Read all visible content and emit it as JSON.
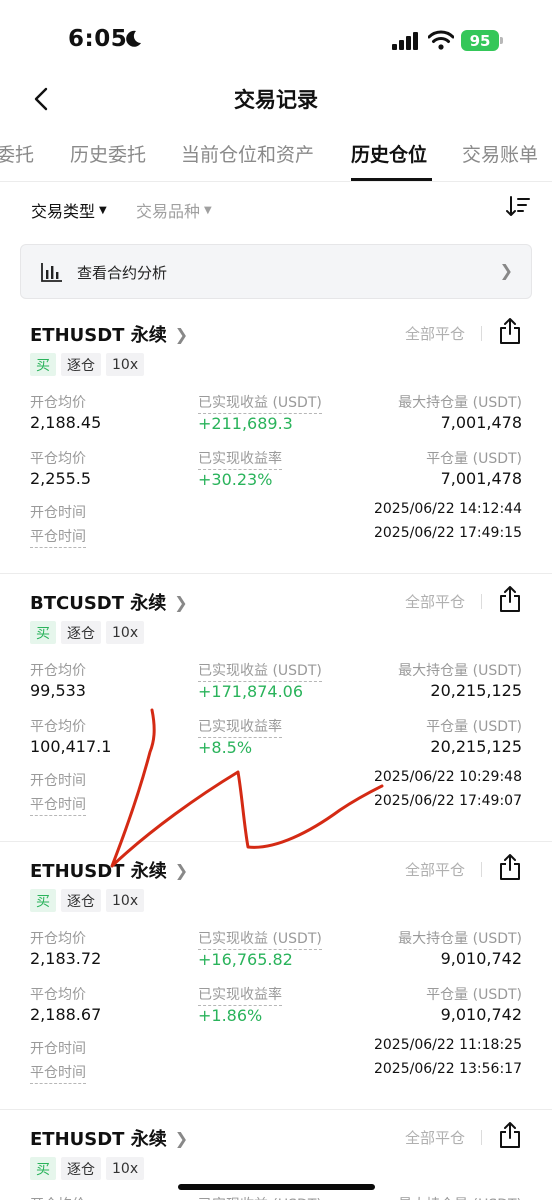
{
  "status_bar": {
    "time": "6:05",
    "battery": "95"
  },
  "header": {
    "title": "交易记录"
  },
  "tabs": [
    {
      "label": "委托"
    },
    {
      "label": "历史委托"
    },
    {
      "label": "当前仓位和资产"
    },
    {
      "label": "历史仓位"
    },
    {
      "label": "交易账单"
    }
  ],
  "filters": {
    "trade_type": "交易类型",
    "instrument": "交易品种"
  },
  "analysis": {
    "label": "查看合约分析"
  },
  "labels": {
    "open_avg": "开仓均价",
    "close_avg": "平仓均价",
    "realized_pnl": "已实现收益 (USDT)",
    "realized_pnl_rate": "已实现收益率",
    "max_position": "最大持仓量 (USDT)",
    "closed_amount": "平仓量 (USDT)",
    "open_time": "开仓时间",
    "close_time": "平仓时间",
    "close_all": "全部平仓"
  },
  "cards": [
    {
      "symbol": "ETHUSDT 永续",
      "side": "买",
      "margin": "逐仓",
      "leverage": "10x",
      "open_avg": "2,188.45",
      "close_avg": "2,255.5",
      "realized_pnl": "+211,689.3",
      "realized_pnl_rate": "+30.23%",
      "max_position": "7,001,478",
      "closed_amount": "7,001,478",
      "open_time": "2025/06/22 14:12:44",
      "close_time": "2025/06/22 17:49:15"
    },
    {
      "symbol": "BTCUSDT 永续",
      "side": "买",
      "margin": "逐仓",
      "leverage": "10x",
      "open_avg": "99,533",
      "close_avg": "100,417.1",
      "realized_pnl": "+171,874.06",
      "realized_pnl_rate": "+8.5%",
      "max_position": "20,215,125",
      "closed_amount": "20,215,125",
      "open_time": "2025/06/22 10:29:48",
      "close_time": "2025/06/22 17:49:07"
    },
    {
      "symbol": "ETHUSDT 永续",
      "side": "买",
      "margin": "逐仓",
      "leverage": "10x",
      "open_avg": "2,183.72",
      "close_avg": "2,188.67",
      "realized_pnl": "+16,765.82",
      "realized_pnl_rate": "+1.86%",
      "max_position": "9,010,742",
      "closed_amount": "9,010,742",
      "open_time": "2025/06/22 11:18:25",
      "close_time": "2025/06/22 13:56:17"
    },
    {
      "symbol": "ETHUSDT 永续",
      "side": "买",
      "margin": "逐仓",
      "leverage": "10x"
    }
  ],
  "colors": {
    "profit_green": "#2ab35b",
    "buy_tag_bg": "#e6f6ec",
    "annotation_red": "#d42a14"
  }
}
